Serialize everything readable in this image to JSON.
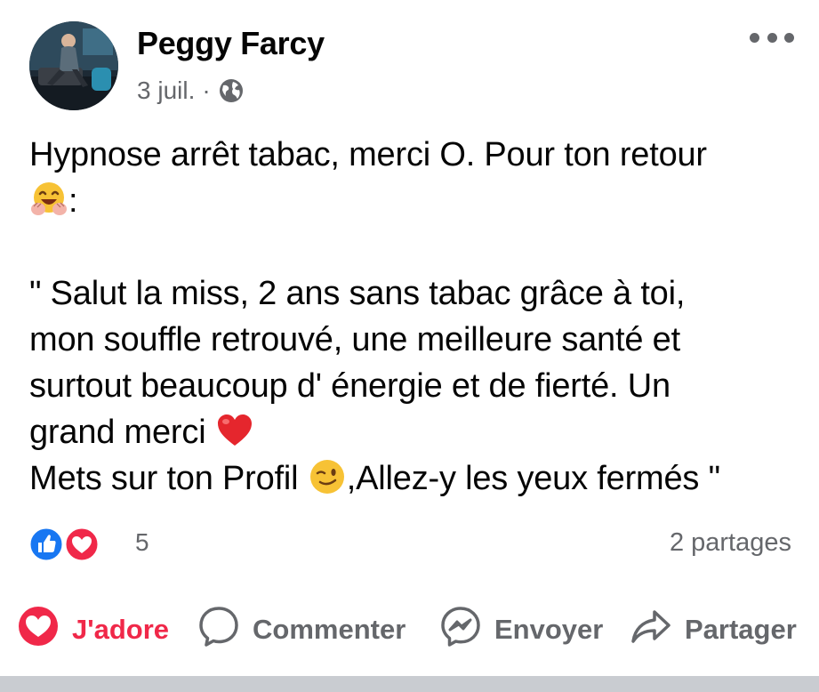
{
  "author": {
    "name": "Peggy Farcy",
    "date": "3 juil.",
    "separator": "·",
    "privacy_icon": "globe-icon",
    "avatar_icon": "avatar"
  },
  "post": {
    "lines": [
      "Hypnose arrêt tabac, merci O. Pour ton retour",
      ":",
      "",
      "\" Salut la miss, 2 ans sans tabac grâce à toi,",
      "mon souffle retrouvé, une meilleure santé et",
      "surtout beaucoup d' énergie et de fierté. Un",
      "grand merci ",
      "Mets sur ton Profil ",
      ",Allez-y les yeux fermés \""
    ],
    "emojis": [
      "hugging-face-emoji",
      "red-heart-emoji",
      "winking-face-emoji"
    ]
  },
  "stats": {
    "reaction_icons": [
      "like-reaction-icon",
      "love-reaction-icon"
    ],
    "reaction_count": "5",
    "shares": "2 partages"
  },
  "actions": {
    "love_label": "J'adore",
    "comment_label": "Commenter",
    "send_label": "Envoyer",
    "share_label": "Partager"
  },
  "colors": {
    "love_red": "#f02849",
    "like_blue": "#1877f2",
    "secondary_text": "#65676b",
    "separator_bar": "#c9ccd1"
  }
}
